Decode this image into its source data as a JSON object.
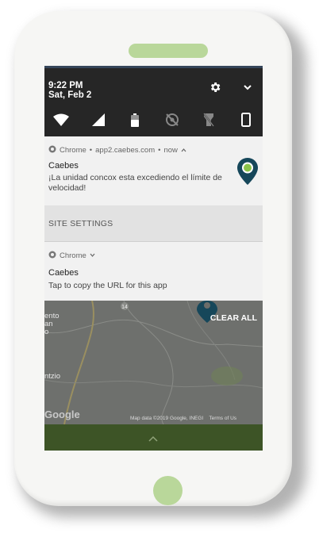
{
  "status_bar": {
    "time": "9:22 PM",
    "date": "Sat, Feb 2",
    "icons": [
      "settings-gear-icon",
      "expand-chevron-icon",
      "wifi-icon",
      "cell-signal-icon",
      "battery-icon",
      "location-off-icon",
      "flashlight-off-icon",
      "portrait-phone-icon"
    ]
  },
  "notification_1": {
    "app": "Chrome",
    "source": "app2.caebes.com",
    "time": "now",
    "title": "Caebes",
    "body": "¡La unidad concox esta excediendo el límite de velocidad!",
    "icon": "map-pin-icon"
  },
  "site_settings": {
    "label": "SITE SETTINGS"
  },
  "notification_2": {
    "app": "Chrome",
    "title": "Caebes",
    "body": "Tap to copy the URL for this app"
  },
  "map": {
    "clear_all": "CLEAR ALL",
    "labels": [
      "ento",
      "an",
      "o",
      "ntzio"
    ],
    "google": "Google",
    "attribution": "Map data ©2019 Google, INEGI",
    "terms": "Terms of Us",
    "route_number": "14"
  },
  "colors": {
    "status_bg": "#262626",
    "notification_bg": "#f1f1f1",
    "pin": "#16475a",
    "pin_dot": "#8bc34a",
    "accent_green": "#b9d79a",
    "bottom_bar": "#3d5426"
  }
}
